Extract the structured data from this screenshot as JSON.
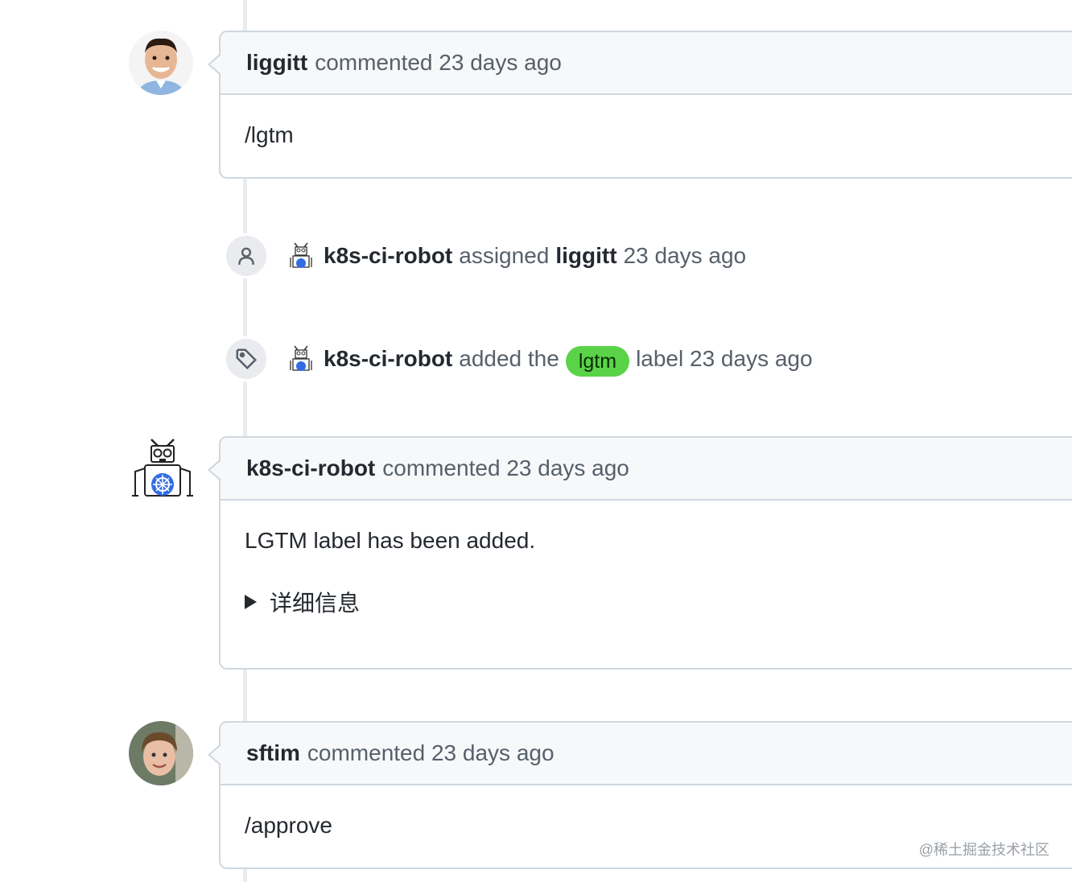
{
  "timeline": {
    "comment1": {
      "author": "liggitt",
      "action": "commented 23 days ago",
      "body": "/lgtm"
    },
    "event1": {
      "icon": "person-icon",
      "actor": "k8s-ci-robot",
      "verb": "assigned",
      "target": "liggitt",
      "time": "23 days ago"
    },
    "event2": {
      "icon": "tag-icon",
      "actor": "k8s-ci-robot",
      "verb": "added the",
      "label": "lgtm",
      "suffix": "label 23 days ago",
      "label_color": "#5ad348"
    },
    "comment2": {
      "author": "k8s-ci-robot",
      "action": "commented 23 days ago",
      "body": "LGTM label has been added.",
      "details": "详细信息"
    },
    "comment3": {
      "author": "sftim",
      "action": "commented 23 days ago",
      "body": "/approve"
    }
  },
  "watermark": "@稀土掘金技术社区"
}
